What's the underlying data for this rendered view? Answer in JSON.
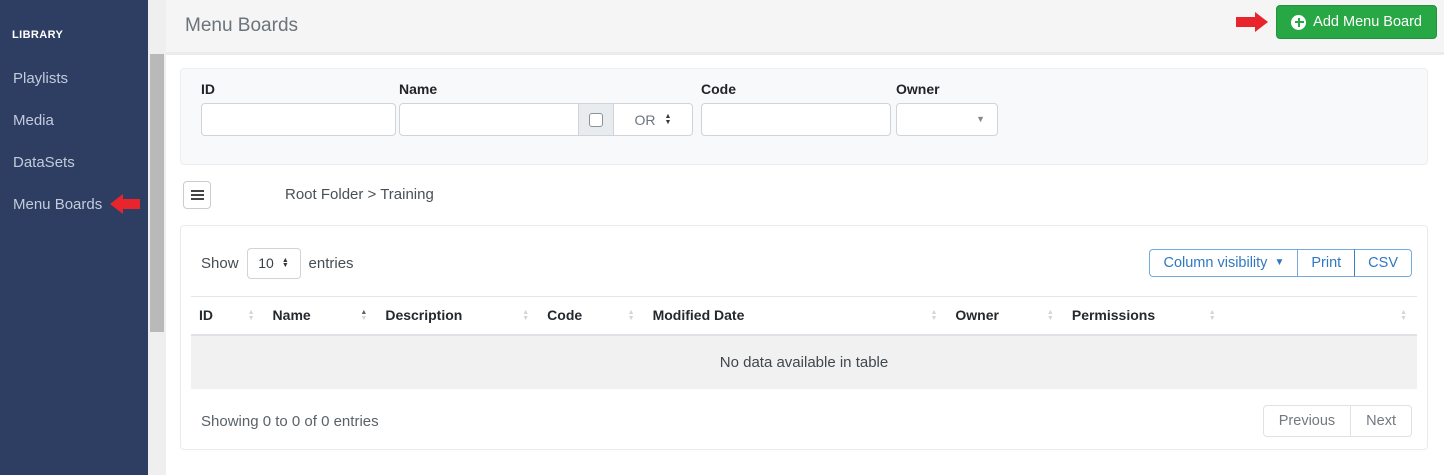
{
  "sidebar": {
    "section_label": "LIBRARY",
    "items": [
      {
        "label": "Playlists",
        "active": false
      },
      {
        "label": "Media",
        "active": false
      },
      {
        "label": "DataSets",
        "active": false
      },
      {
        "label": "Menu Boards",
        "active": true,
        "annotated": true
      }
    ]
  },
  "header": {
    "title": "Menu Boards",
    "add_button_label": "Add Menu Board",
    "add_button_icon": "plus-circle-icon"
  },
  "filters": {
    "id_label": "ID",
    "name_label": "Name",
    "code_label": "Code",
    "owner_label": "Owner",
    "id_value": "",
    "name_value": "",
    "code_value": "",
    "owner_value": "",
    "name_checkbox_checked": false,
    "logic_operator_selected": "OR"
  },
  "breadcrumb": {
    "path": "Root Folder > Training"
  },
  "table": {
    "show_label": "Show",
    "page_length": "10",
    "entries_label": "entries",
    "buttons": [
      "Column visibility",
      "Print",
      "CSV"
    ],
    "columns": [
      "ID",
      "Name",
      "Description",
      "Code",
      "Modified Date",
      "Owner",
      "Permissions",
      ""
    ],
    "sorted_column": "Name",
    "sort_direction": "asc",
    "empty_message": "No data available in table",
    "summary": "Showing 0 to 0 of 0 entries",
    "pagination": {
      "previous_label": "Previous",
      "next_label": "Next"
    }
  },
  "colors": {
    "sidebar_bg": "#2e3e63",
    "accent_green": "#28a745",
    "annotation_red": "#e8252c",
    "button_blue": "#3078c1"
  }
}
